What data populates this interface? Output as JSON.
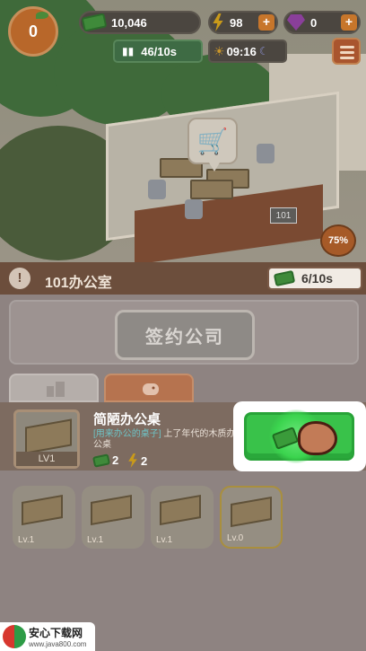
{
  "hud": {
    "orange_count": "0",
    "cash": "10,046",
    "energy": "98",
    "gems": "0",
    "rate": "46/10s",
    "time": "09:16"
  },
  "scene": {
    "room_number": "101",
    "progress": "75%"
  },
  "panel": {
    "room_title": "101办公室",
    "income": "6/10s",
    "sign_button": "签约公司"
  },
  "item": {
    "name": "简陋办公桌",
    "desc_highlight": "[用来办公的桌子]",
    "desc_rest": "上了年代的木质办公桌",
    "level_label": "LV1",
    "cost_cash": "2",
    "cost_energy": "2"
  },
  "desk_slots": [
    {
      "level": "Lv.1"
    },
    {
      "level": "Lv.1"
    },
    {
      "level": "Lv.1"
    },
    {
      "level": "Lv.0"
    }
  ],
  "watermark": {
    "title": "安心下载网",
    "url": "www.java800.com"
  },
  "icons": {
    "orange": "orange-icon",
    "cash": "cash-icon",
    "energy": "bolt-icon",
    "gem": "gem-icon",
    "menu": "menu-icon",
    "cart": "cart-icon"
  }
}
